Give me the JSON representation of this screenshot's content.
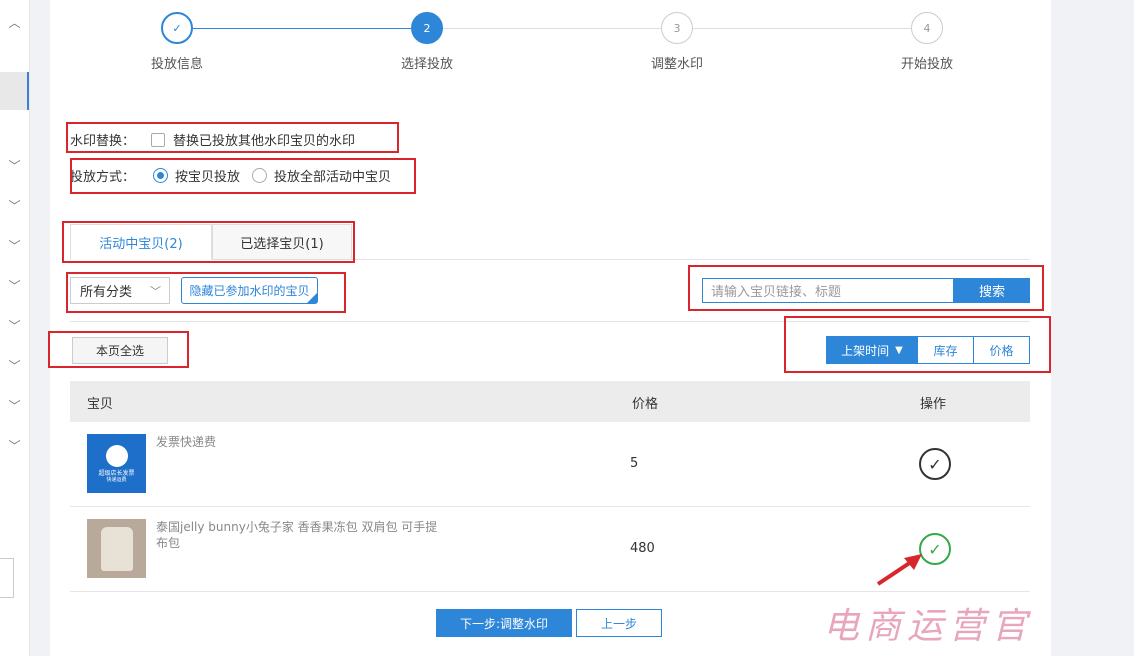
{
  "steps": [
    {
      "num": "✓",
      "label": "投放信息",
      "state": "done"
    },
    {
      "num": "2",
      "label": "选择投放",
      "state": "active"
    },
    {
      "num": "3",
      "label": "调整水印",
      "state": "todo"
    },
    {
      "num": "4",
      "label": "开始投放",
      "state": "todo"
    }
  ],
  "watermark_replace": {
    "label": "水印替换：",
    "option": "替换已投放其他水印宝贝的水印",
    "checked": false
  },
  "delivery_method": {
    "label": "投放方式：",
    "options": [
      {
        "label": "按宝贝投放",
        "selected": true
      },
      {
        "label": "投放全部活动中宝贝",
        "selected": false
      }
    ]
  },
  "tabs": [
    {
      "label": "活动中宝贝(2)",
      "active": true
    },
    {
      "label": "已选择宝贝(1)",
      "active": false
    }
  ],
  "filter": {
    "category": "所有分类",
    "hide_btn": "隐藏已参加水印的宝贝"
  },
  "search": {
    "placeholder": "请输入宝贝链接、标题",
    "button": "搜索"
  },
  "select_all": "本页全选",
  "sort": [
    {
      "label": "上架时间",
      "active": true,
      "icon": "caret-down-icon"
    },
    {
      "label": "库存",
      "active": false
    },
    {
      "label": "价格",
      "active": false
    }
  ],
  "table": {
    "headers": [
      "宝贝",
      "价格",
      "操作"
    ],
    "rows": [
      {
        "name": "发票快递费",
        "price": "5",
        "selected": false,
        "thumb_text": "超级店长发票",
        "thumb_sub": "快递运费"
      },
      {
        "name": "泰国jelly bunny小兔子家 香香果冻包 双肩包 可手提布包",
        "price": "480",
        "selected": true
      }
    ]
  },
  "buttons": {
    "next": "下一步:调整水印",
    "prev": "上一步"
  },
  "watermark_text": "电商运营官",
  "colors": {
    "accent": "#2e86d9",
    "highlight": "#d9262c",
    "success": "#35a84a"
  }
}
